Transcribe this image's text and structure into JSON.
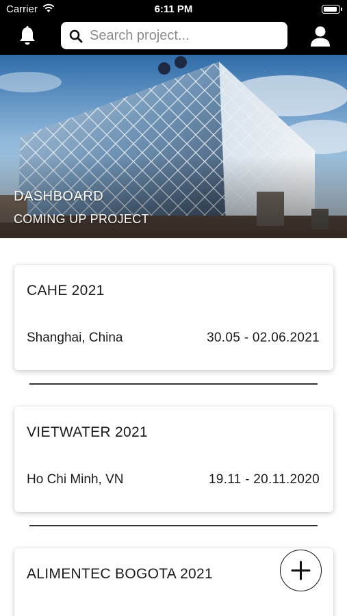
{
  "status_bar": {
    "carrier": "Carrier",
    "time": "6:11 PM"
  },
  "header": {
    "search_placeholder": "Search project...",
    "bell_icon": "bell-icon",
    "user_icon": "user-icon",
    "background_color": "#000000"
  },
  "hero": {
    "title": "DASHBOARD",
    "subtitle": "COMING UP PROJECT"
  },
  "projects": [
    {
      "name": "CAHE 2021",
      "location": "Shanghai, China",
      "dates": "30.05 - 02.06.2021"
    },
    {
      "name": "VIETWATER 2021",
      "location": "Ho Chi Minh, VN",
      "dates": "19.11 - 20.11.2020"
    },
    {
      "name": "ALIMENTEC BOGOTA 2021",
      "location": "",
      "dates": ""
    }
  ],
  "fab": {
    "icon": "plus-icon"
  }
}
